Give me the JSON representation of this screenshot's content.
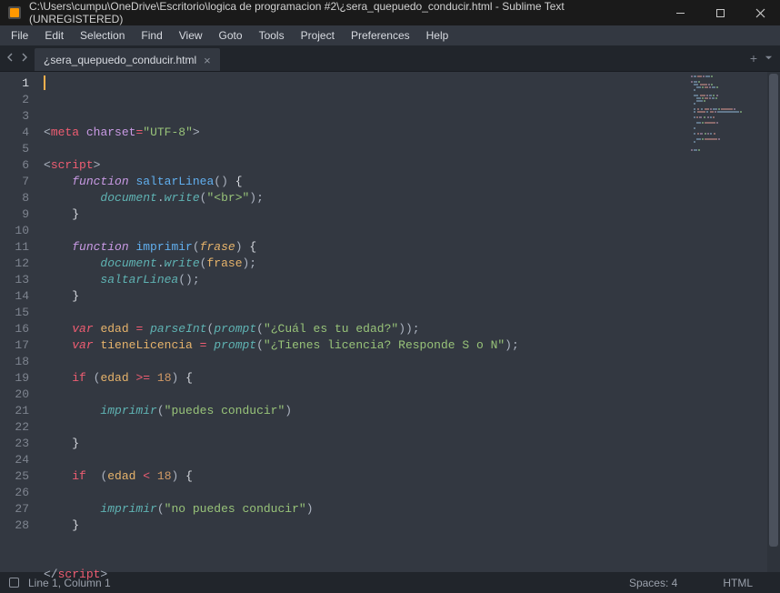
{
  "window": {
    "title": "C:\\Users\\cumpu\\OneDrive\\Escritorio\\logica de programacion #2\\¿sera_quepuedo_conducir.html - Sublime Text (UNREGISTERED)"
  },
  "menu": {
    "items": [
      "File",
      "Edit",
      "Selection",
      "Find",
      "View",
      "Goto",
      "Tools",
      "Project",
      "Preferences",
      "Help"
    ]
  },
  "tabs": {
    "active": {
      "label": "¿sera_quepuedo_conducir.html"
    }
  },
  "editor": {
    "line_count": 28,
    "active_line": 1,
    "code_lines": [
      [
        {
          "c": "tok-punc",
          "t": "<"
        },
        {
          "c": "tok-tag",
          "t": "meta"
        },
        {
          "c": "",
          "t": " "
        },
        {
          "c": "tok-attr",
          "t": "charset"
        },
        {
          "c": "tok-op",
          "t": "="
        },
        {
          "c": "tok-str",
          "t": "\"UTF-8\""
        },
        {
          "c": "tok-punc",
          "t": ">"
        }
      ],
      [],
      [
        {
          "c": "tok-punc",
          "t": "<"
        },
        {
          "c": "tok-tag",
          "t": "script"
        },
        {
          "c": "tok-punc",
          "t": ">"
        }
      ],
      [
        {
          "c": "",
          "t": "    "
        },
        {
          "c": "tok-kw",
          "t": "function"
        },
        {
          "c": "",
          "t": " "
        },
        {
          "c": "tok-fn",
          "t": "saltarLinea"
        },
        {
          "c": "tok-punc",
          "t": "()"
        },
        {
          "c": "",
          "t": " "
        },
        {
          "c": "tok-br",
          "t": "{"
        }
      ],
      [
        {
          "c": "",
          "t": "        "
        },
        {
          "c": "tok-obj",
          "t": "document"
        },
        {
          "c": "tok-punc",
          "t": "."
        },
        {
          "c": "tok-fni",
          "t": "write"
        },
        {
          "c": "tok-punc",
          "t": "("
        },
        {
          "c": "tok-str",
          "t": "\"<br>\""
        },
        {
          "c": "tok-punc",
          "t": ");"
        }
      ],
      [
        {
          "c": "",
          "t": "    "
        },
        {
          "c": "tok-br",
          "t": "}"
        }
      ],
      [],
      [
        {
          "c": "",
          "t": "    "
        },
        {
          "c": "tok-kw",
          "t": "function"
        },
        {
          "c": "",
          "t": " "
        },
        {
          "c": "tok-fn",
          "t": "imprimir"
        },
        {
          "c": "tok-punc",
          "t": "("
        },
        {
          "c": "tok-param",
          "t": "frase"
        },
        {
          "c": "tok-punc",
          "t": ")"
        },
        {
          "c": "",
          "t": " "
        },
        {
          "c": "tok-br",
          "t": "{"
        }
      ],
      [
        {
          "c": "",
          "t": "        "
        },
        {
          "c": "tok-obj",
          "t": "document"
        },
        {
          "c": "tok-punc",
          "t": "."
        },
        {
          "c": "tok-fni",
          "t": "write"
        },
        {
          "c": "tok-punc",
          "t": "("
        },
        {
          "c": "tok-var",
          "t": "frase"
        },
        {
          "c": "tok-punc",
          "t": ");"
        }
      ],
      [
        {
          "c": "",
          "t": "        "
        },
        {
          "c": "tok-fni",
          "t": "saltarLinea"
        },
        {
          "c": "tok-punc",
          "t": "();"
        }
      ],
      [
        {
          "c": "",
          "t": "    "
        },
        {
          "c": "tok-br",
          "t": "}"
        }
      ],
      [],
      [
        {
          "c": "",
          "t": "    "
        },
        {
          "c": "tok-kw2",
          "t": "var"
        },
        {
          "c": "",
          "t": " "
        },
        {
          "c": "tok-var",
          "t": "edad"
        },
        {
          "c": "",
          "t": " "
        },
        {
          "c": "tok-op",
          "t": "="
        },
        {
          "c": "",
          "t": " "
        },
        {
          "c": "tok-fni",
          "t": "parseInt"
        },
        {
          "c": "tok-punc",
          "t": "("
        },
        {
          "c": "tok-fni",
          "t": "prompt"
        },
        {
          "c": "tok-punc",
          "t": "("
        },
        {
          "c": "tok-str",
          "t": "\"¿Cuál es tu edad?\""
        },
        {
          "c": "tok-punc",
          "t": "));"
        }
      ],
      [
        {
          "c": "",
          "t": "    "
        },
        {
          "c": "tok-kw2",
          "t": "var"
        },
        {
          "c": "",
          "t": " "
        },
        {
          "c": "tok-var",
          "t": "tieneLicencia"
        },
        {
          "c": "",
          "t": " "
        },
        {
          "c": "tok-op",
          "t": "="
        },
        {
          "c": "",
          "t": " "
        },
        {
          "c": "tok-fni",
          "t": "prompt"
        },
        {
          "c": "tok-punc",
          "t": "("
        },
        {
          "c": "tok-str",
          "t": "\"¿Tienes licencia? Responde S o N\""
        },
        {
          "c": "tok-punc",
          "t": ");"
        }
      ],
      [],
      [
        {
          "c": "",
          "t": "    "
        },
        {
          "c": "tok-op",
          "t": "if"
        },
        {
          "c": "",
          "t": " "
        },
        {
          "c": "tok-punc",
          "t": "("
        },
        {
          "c": "tok-var",
          "t": "edad"
        },
        {
          "c": "",
          "t": " "
        },
        {
          "c": "tok-op",
          "t": ">="
        },
        {
          "c": "",
          "t": " "
        },
        {
          "c": "tok-num",
          "t": "18"
        },
        {
          "c": "tok-punc",
          "t": ")"
        },
        {
          "c": "",
          "t": " "
        },
        {
          "c": "tok-br",
          "t": "{"
        }
      ],
      [],
      [
        {
          "c": "",
          "t": "        "
        },
        {
          "c": "tok-fni",
          "t": "imprimir"
        },
        {
          "c": "tok-punc",
          "t": "("
        },
        {
          "c": "tok-str",
          "t": "\"puedes conducir\""
        },
        {
          "c": "tok-punc",
          "t": ")"
        }
      ],
      [],
      [
        {
          "c": "",
          "t": "    "
        },
        {
          "c": "tok-br",
          "t": "}"
        }
      ],
      [],
      [
        {
          "c": "",
          "t": "    "
        },
        {
          "c": "tok-op",
          "t": "if"
        },
        {
          "c": "",
          "t": "  "
        },
        {
          "c": "tok-punc",
          "t": "("
        },
        {
          "c": "tok-var",
          "t": "edad"
        },
        {
          "c": "",
          "t": " "
        },
        {
          "c": "tok-op",
          "t": "<"
        },
        {
          "c": "",
          "t": " "
        },
        {
          "c": "tok-num",
          "t": "18"
        },
        {
          "c": "tok-punc",
          "t": ")"
        },
        {
          "c": "",
          "t": " "
        },
        {
          "c": "tok-br",
          "t": "{"
        }
      ],
      [],
      [
        {
          "c": "",
          "t": "        "
        },
        {
          "c": "tok-fni",
          "t": "imprimir"
        },
        {
          "c": "tok-punc",
          "t": "("
        },
        {
          "c": "tok-str",
          "t": "\"no puedes conducir\""
        },
        {
          "c": "tok-punc",
          "t": ")"
        }
      ],
      [
        {
          "c": "",
          "t": "    "
        },
        {
          "c": "tok-br",
          "t": "}"
        }
      ],
      [],
      [],
      [
        {
          "c": "tok-punc",
          "t": "</"
        },
        {
          "c": "tok-tag",
          "t": "script"
        },
        {
          "c": "tok-punc",
          "t": ">"
        }
      ]
    ]
  },
  "status": {
    "cursor": "Line 1, Column 1",
    "spaces": "Spaces: 4",
    "syntax": "HTML"
  }
}
